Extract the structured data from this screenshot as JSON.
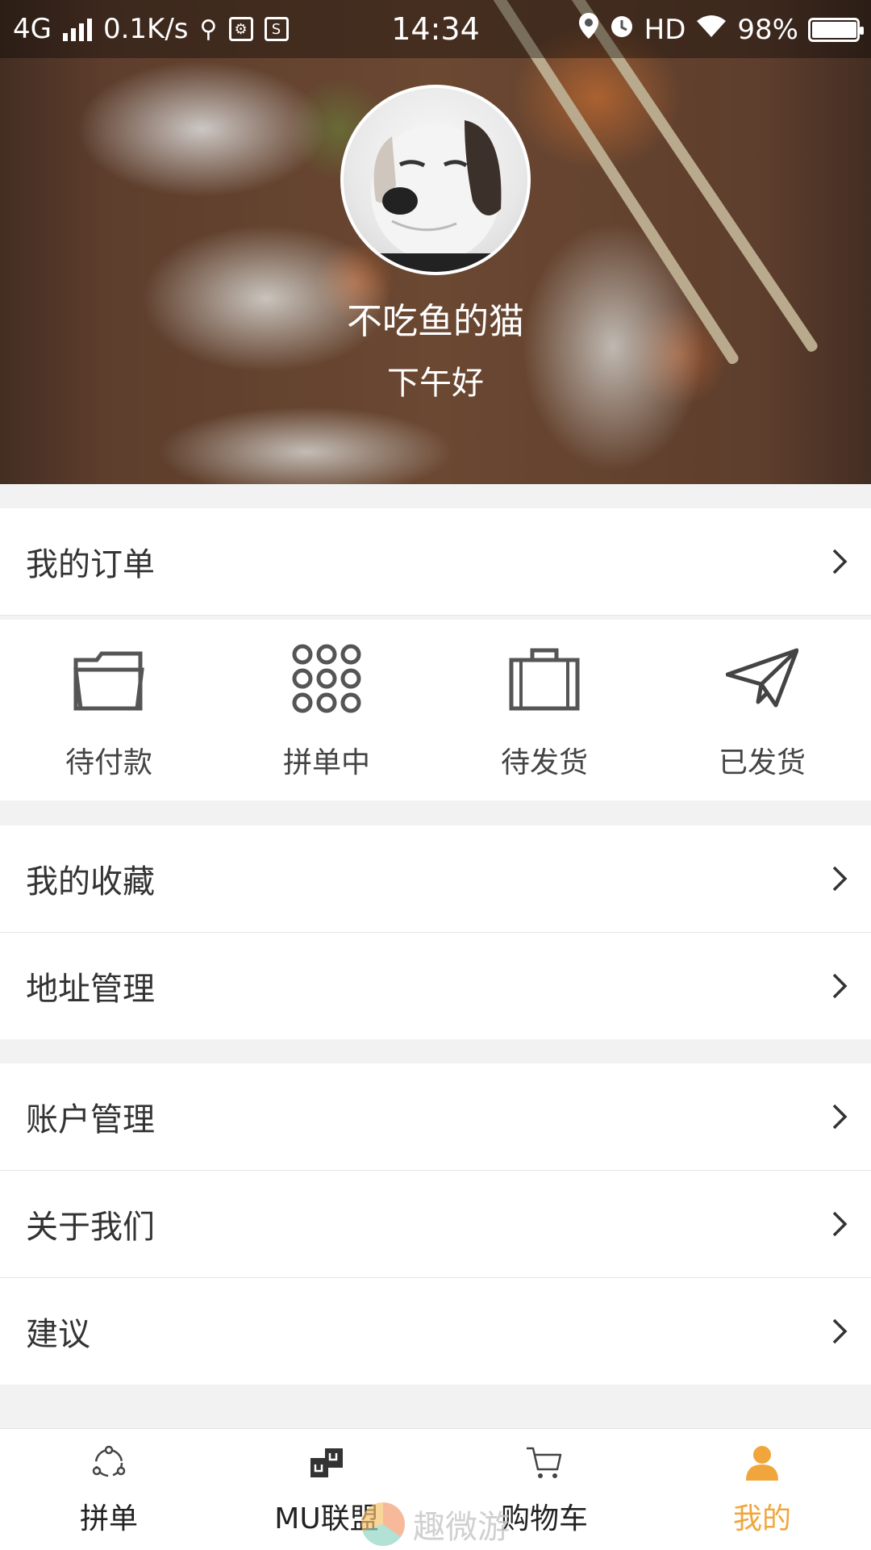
{
  "status_bar": {
    "network": "4G",
    "speed": "0.1K/s",
    "time": "14:34",
    "hd": "HD",
    "battery": "98%",
    "battery_level": 0.98
  },
  "profile": {
    "username": "不吃鱼的猫",
    "greeting": "下午好"
  },
  "menu": {
    "my_orders": "我的订单",
    "order_status": [
      {
        "label": "待付款",
        "icon": "folder-icon"
      },
      {
        "label": "拼单中",
        "icon": "grid-dots-icon"
      },
      {
        "label": "待发货",
        "icon": "briefcase-icon"
      },
      {
        "label": "已发货",
        "icon": "paper-plane-icon"
      }
    ],
    "favorites": "我的收藏",
    "address": "地址管理",
    "account": "账户管理",
    "about": "关于我们",
    "suggestion": "建议"
  },
  "tabbar": {
    "items": [
      {
        "label": "拼单",
        "icon": "group-icon"
      },
      {
        "label": "MU联盟",
        "icon": "mu-alliance-icon"
      },
      {
        "label": "购物车",
        "icon": "cart-icon"
      },
      {
        "label": "我的",
        "icon": "user-icon"
      }
    ],
    "active_index": 3,
    "active_color": "#f0a63c"
  },
  "watermark": "趣微游"
}
